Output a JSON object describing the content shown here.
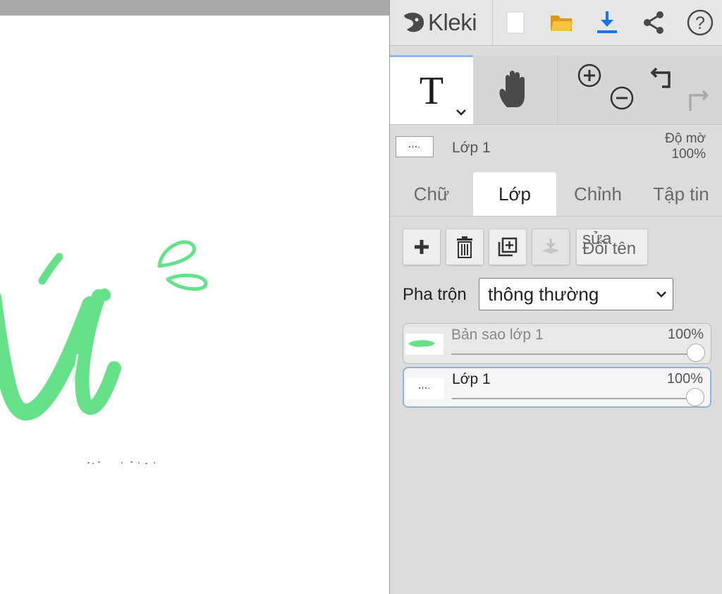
{
  "app": {
    "name": "Kleki"
  },
  "colors": {
    "accent": "#1a73e8",
    "folder": "#f2b826",
    "stroke_green": "#67e08a",
    "panel_bg": "#dcdcdc",
    "active_border": "#8fb3e2"
  },
  "topbar": {
    "icons": [
      "new-document-icon",
      "open-folder-icon",
      "download-icon",
      "share-icon",
      "help-icon"
    ]
  },
  "tools": {
    "active": "text",
    "text_glyph": "T",
    "icons": [
      "text-tool-icon",
      "hand-tool-icon",
      "zoom-in-icon",
      "zoom-out-icon",
      "undo-icon",
      "redo-icon"
    ]
  },
  "layer_info": {
    "name": "Lớp 1",
    "opacity_label": "Độ mờ",
    "opacity_value": "100%"
  },
  "tabs": [
    {
      "label": "Chữ",
      "active": false
    },
    {
      "label": "Lớp",
      "active": true
    },
    {
      "label": "Chỉnh",
      "active": false
    },
    {
      "label": "Tập tin",
      "active": false
    }
  ],
  "layer_actions": {
    "icons": [
      "add-layer-icon",
      "delete-layer-icon",
      "duplicate-layer-icon",
      "merge-down-icon"
    ],
    "rename_text_a": "sửa",
    "rename_text_b": "Đổi tên"
  },
  "blend": {
    "label": "Pha trộn",
    "value": "thông thường"
  },
  "layers": [
    {
      "name": "Bản sao lớp 1",
      "opacity": "100%",
      "selected": false
    },
    {
      "name": "Lớp 1",
      "opacity": "100%",
      "selected": true
    }
  ]
}
